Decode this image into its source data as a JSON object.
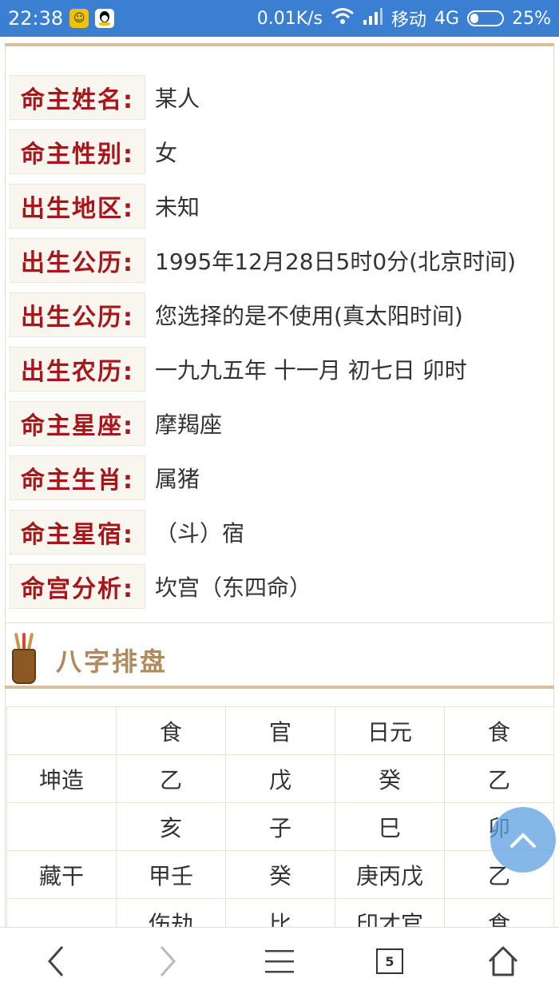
{
  "status_bar": {
    "time": "22:38",
    "network_speed": "0.01K/s",
    "carrier": "移动",
    "network_type": "4G",
    "battery": "25%",
    "battery_level": 0.25,
    "icons": [
      "app-notification-icon",
      "qq-icon",
      "wifi-icon",
      "signal-icon",
      "battery-icon"
    ]
  },
  "info": {
    "rows": [
      {
        "label": "命主姓名:",
        "value": "某人"
      },
      {
        "label": "命主性别:",
        "value": "女"
      },
      {
        "label": "出生地区:",
        "value": "未知"
      },
      {
        "label": "出生公历:",
        "value": "1995年12月28日5时0分(北京时间)"
      },
      {
        "label": "出生公历:",
        "value": "您选择的是不使用(真太阳时间)"
      },
      {
        "label": "出生农历:",
        "value": "一九九五年 十一月 初七日 卯时"
      },
      {
        "label": "命主星座:",
        "value": "摩羯座"
      },
      {
        "label": "命主生肖:",
        "value": "属猪"
      },
      {
        "label": "命主星宿:",
        "value": "（斗）宿"
      },
      {
        "label": "命宫分析:",
        "value": "坎宫（东四命）"
      }
    ]
  },
  "bazi_section": {
    "title": "八字排盘",
    "icon": "brush-holder-icon",
    "rows": [
      [
        "",
        "食",
        "官",
        "日元",
        "食"
      ],
      [
        "坤造",
        "乙",
        "戊",
        "癸",
        "乙"
      ],
      [
        "",
        "亥",
        "子",
        "巳",
        "卯"
      ],
      [
        "藏干",
        "甲壬",
        "癸",
        "庚丙戊",
        "乙"
      ],
      [
        "",
        "伤劫",
        "比",
        "印才官",
        "食"
      ]
    ]
  },
  "bottom_bar": {
    "tab_count": "5",
    "icons": [
      "back-icon",
      "forward-icon",
      "menu-icon",
      "tabs-icon",
      "home-icon"
    ]
  },
  "colors": {
    "status_bar": "#3a7fd1",
    "label_text": "#a8161b",
    "label_bg": "#f9f5ef",
    "section_title": "#b08a5a",
    "rule": "#d9bf9e",
    "to_top_button": "#5ca0e1"
  }
}
